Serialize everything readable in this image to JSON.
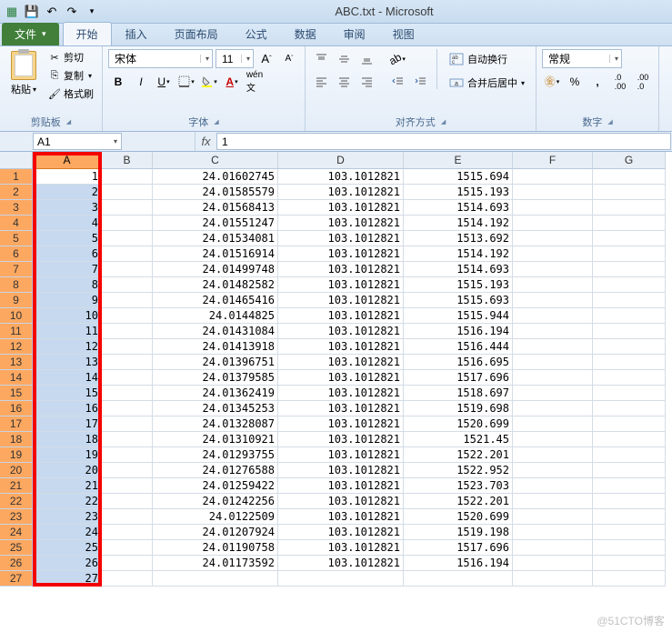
{
  "title": "ABC.txt - Microsoft",
  "qat": {
    "save": "💾",
    "undo": "↶",
    "redo": "↷"
  },
  "tabs": {
    "file": "文件",
    "items": [
      "开始",
      "插入",
      "页面布局",
      "公式",
      "数据",
      "审阅",
      "视图"
    ],
    "active": 0
  },
  "ribbon": {
    "clipboard": {
      "label": "剪贴板",
      "paste": "粘贴",
      "cut": "剪切",
      "copy": "复制",
      "format_painter": "格式刷"
    },
    "font": {
      "label": "字体",
      "name": "宋体",
      "size": "11"
    },
    "align": {
      "label": "对齐方式",
      "wrap": "自动换行",
      "merge": "合并后居中"
    },
    "number": {
      "label": "数字",
      "format": "常规"
    }
  },
  "namebox": "A1",
  "formula": "1",
  "columns": [
    "A",
    "B",
    "C",
    "D",
    "E",
    "F",
    "G"
  ],
  "selected_col": "A",
  "chart_data": {
    "type": "table",
    "columns": [
      "A",
      "B",
      "C",
      "D",
      "E"
    ],
    "rows": [
      {
        "A": "1",
        "B": "",
        "C": "24.01602745",
        "D": "103.1012821",
        "E": "1515.694"
      },
      {
        "A": "2",
        "B": "",
        "C": "24.01585579",
        "D": "103.1012821",
        "E": "1515.193"
      },
      {
        "A": "3",
        "B": "",
        "C": "24.01568413",
        "D": "103.1012821",
        "E": "1514.693"
      },
      {
        "A": "4",
        "B": "",
        "C": "24.01551247",
        "D": "103.1012821",
        "E": "1514.192"
      },
      {
        "A": "5",
        "B": "",
        "C": "24.01534081",
        "D": "103.1012821",
        "E": "1513.692"
      },
      {
        "A": "6",
        "B": "",
        "C": "24.01516914",
        "D": "103.1012821",
        "E": "1514.192"
      },
      {
        "A": "7",
        "B": "",
        "C": "24.01499748",
        "D": "103.1012821",
        "E": "1514.693"
      },
      {
        "A": "8",
        "B": "",
        "C": "24.01482582",
        "D": "103.1012821",
        "E": "1515.193"
      },
      {
        "A": "9",
        "B": "",
        "C": "24.01465416",
        "D": "103.1012821",
        "E": "1515.693"
      },
      {
        "A": "10",
        "B": "",
        "C": "24.0144825",
        "D": "103.1012821",
        "E": "1515.944"
      },
      {
        "A": "11",
        "B": "",
        "C": "24.01431084",
        "D": "103.1012821",
        "E": "1516.194"
      },
      {
        "A": "12",
        "B": "",
        "C": "24.01413918",
        "D": "103.1012821",
        "E": "1516.444"
      },
      {
        "A": "13",
        "B": "",
        "C": "24.01396751",
        "D": "103.1012821",
        "E": "1516.695"
      },
      {
        "A": "14",
        "B": "",
        "C": "24.01379585",
        "D": "103.1012821",
        "E": "1517.696"
      },
      {
        "A": "15",
        "B": "",
        "C": "24.01362419",
        "D": "103.1012821",
        "E": "1518.697"
      },
      {
        "A": "16",
        "B": "",
        "C": "24.01345253",
        "D": "103.1012821",
        "E": "1519.698"
      },
      {
        "A": "17",
        "B": "",
        "C": "24.01328087",
        "D": "103.1012821",
        "E": "1520.699"
      },
      {
        "A": "18",
        "B": "",
        "C": "24.01310921",
        "D": "103.1012821",
        "E": "1521.45"
      },
      {
        "A": "19",
        "B": "",
        "C": "24.01293755",
        "D": "103.1012821",
        "E": "1522.201"
      },
      {
        "A": "20",
        "B": "",
        "C": "24.01276588",
        "D": "103.1012821",
        "E": "1522.952"
      },
      {
        "A": "21",
        "B": "",
        "C": "24.01259422",
        "D": "103.1012821",
        "E": "1523.703"
      },
      {
        "A": "22",
        "B": "",
        "C": "24.01242256",
        "D": "103.1012821",
        "E": "1522.201"
      },
      {
        "A": "23",
        "B": "",
        "C": "24.0122509",
        "D": "103.1012821",
        "E": "1520.699"
      },
      {
        "A": "24",
        "B": "",
        "C": "24.01207924",
        "D": "103.1012821",
        "E": "1519.198"
      },
      {
        "A": "25",
        "B": "",
        "C": "24.01190758",
        "D": "103.1012821",
        "E": "1517.696"
      },
      {
        "A": "26",
        "B": "",
        "C": "24.01173592",
        "D": "103.1012821",
        "E": "1516.194"
      },
      {
        "A": "27",
        "B": "",
        "C": "",
        "D": "",
        "E": ""
      }
    ]
  },
  "watermark": "@51CTO博客"
}
